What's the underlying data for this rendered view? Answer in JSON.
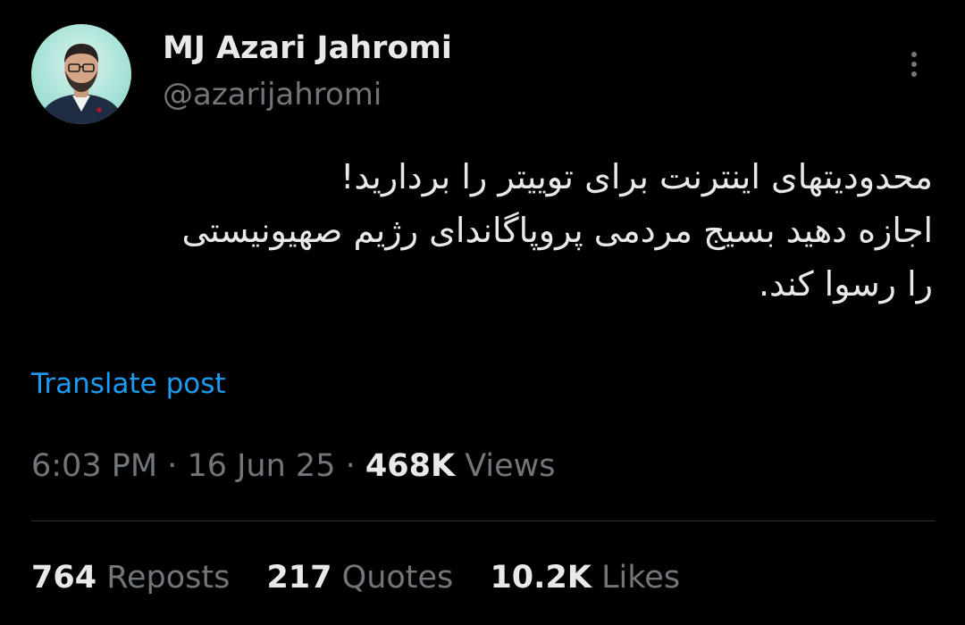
{
  "author": {
    "display_name": "MJ Azari Jahromi",
    "handle": "@azarijahromi",
    "avatar_icon": "profile-photo"
  },
  "more_icon": "more-vertical-icon",
  "tweet": {
    "lines": [
      "محدودیتهای اینترنت برای توییتر را بردارید!",
      "اجازه دهید بسیج مردمی پروپاگاندای رژیم صهیونیستی",
      "را رسوا کند."
    ]
  },
  "translate_label": "Translate post",
  "meta": {
    "time": "6:03 PM",
    "separator": "·",
    "date": "16 Jun 25",
    "views_count": "468K",
    "views_label": "Views"
  },
  "stats": {
    "reposts": {
      "count": "764",
      "label": "Reposts"
    },
    "quotes": {
      "count": "217",
      "label": "Quotes"
    },
    "likes": {
      "count": "10.2K",
      "label": "Likes"
    }
  },
  "colors": {
    "background": "#000000",
    "text_primary": "#e7e9ea",
    "text_secondary": "#71767b",
    "link": "#1d9bf0",
    "divider": "#2f3336"
  }
}
